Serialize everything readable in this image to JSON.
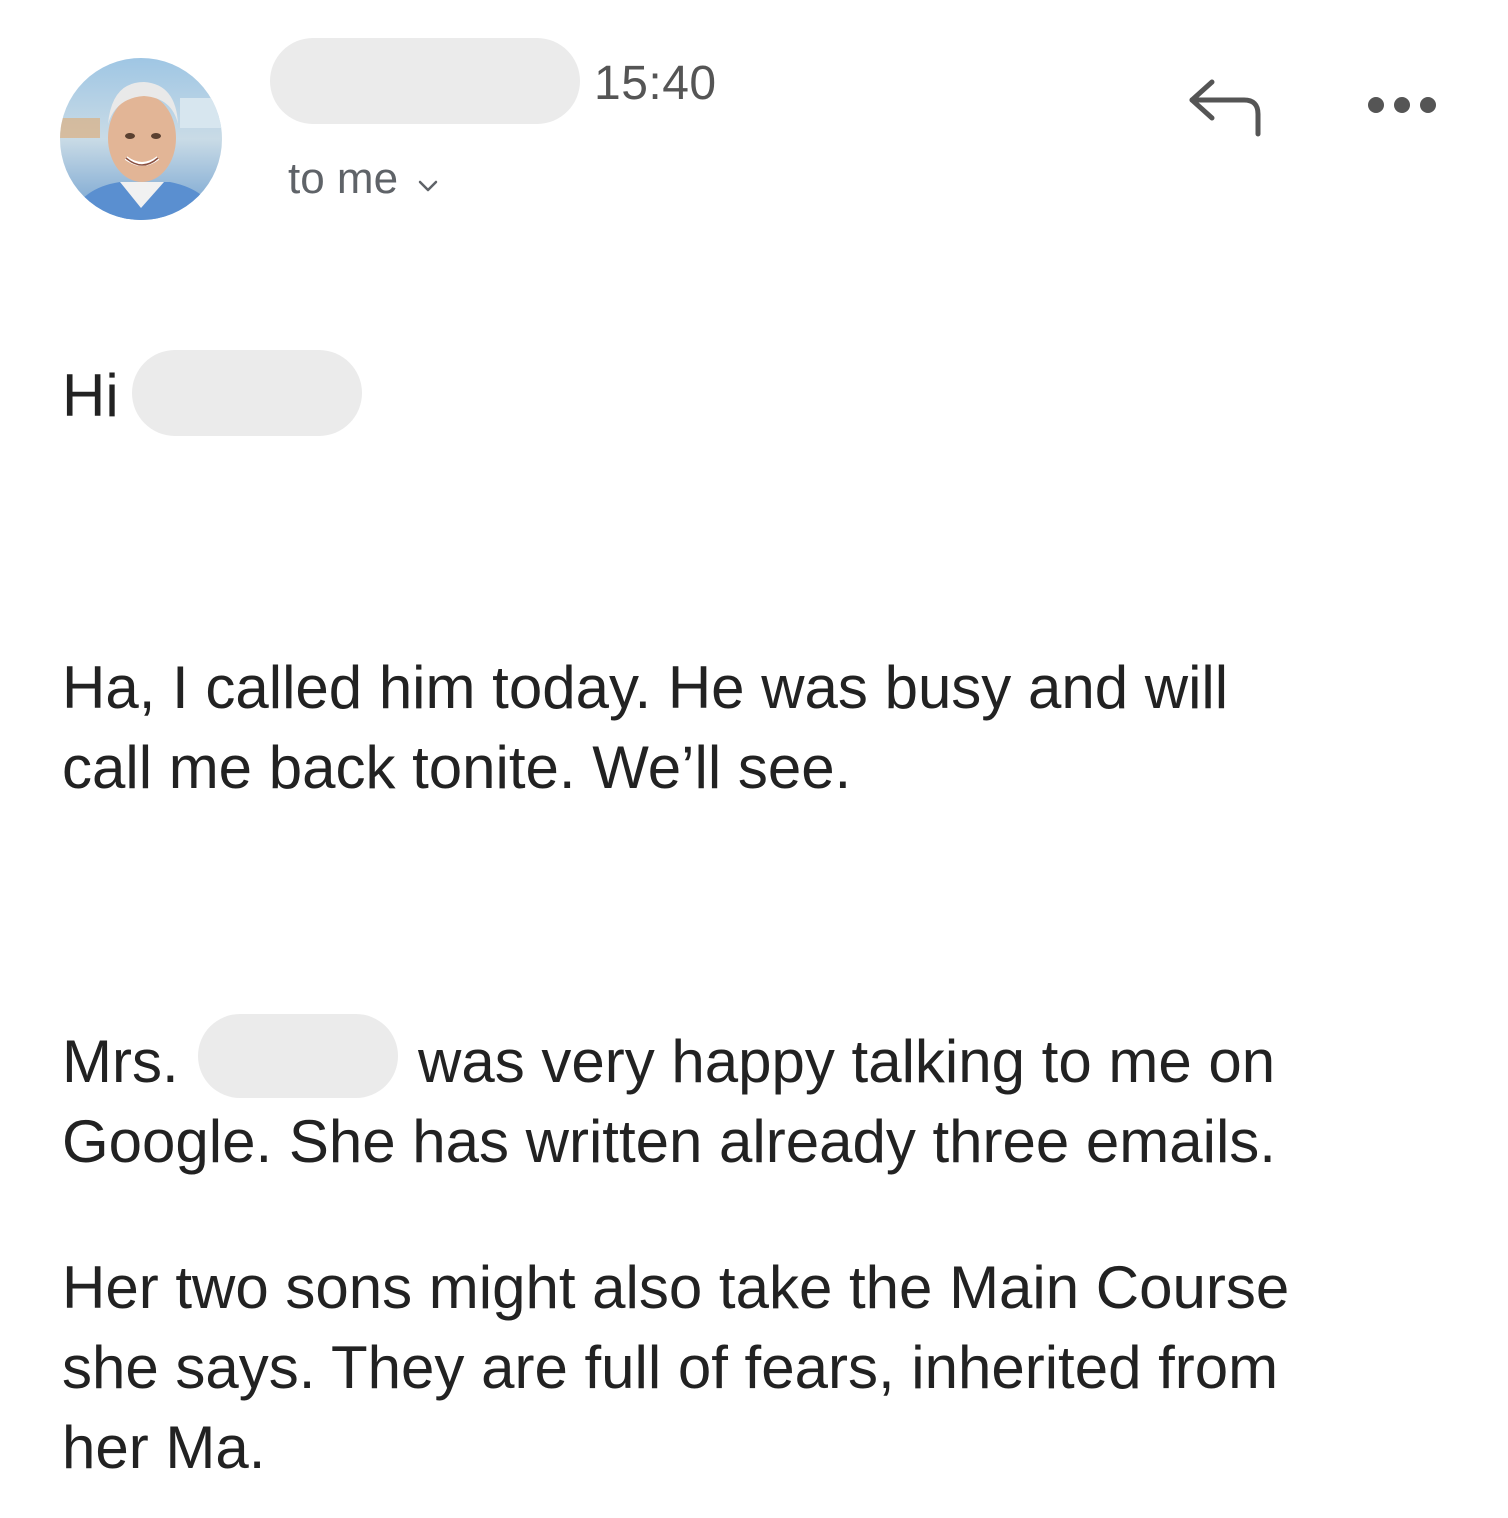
{
  "header": {
    "time": "15:40",
    "recipient_label": "to me",
    "icons": {
      "reply": "reply-icon",
      "more": "more-icon",
      "chevron": "chevron-down-icon"
    }
  },
  "message": {
    "greeting": "Hi",
    "paragraph1": [
      "Ha, I called him today. He was busy and will",
      "call me back tonite. We’ll see."
    ],
    "paragraph2": {
      "prefix": "Mrs.",
      "line1_rest": "was very happy talking to me on",
      "line2": "Google. She has written already three emails."
    },
    "paragraph3": [
      "Her two sons might also take the Main Course",
      "she says. They are full of fears, inherited from",
      "her Ma."
    ]
  },
  "colors": {
    "redaction": "#ebebeb",
    "text": "#222222",
    "secondary": "#5f6368"
  }
}
